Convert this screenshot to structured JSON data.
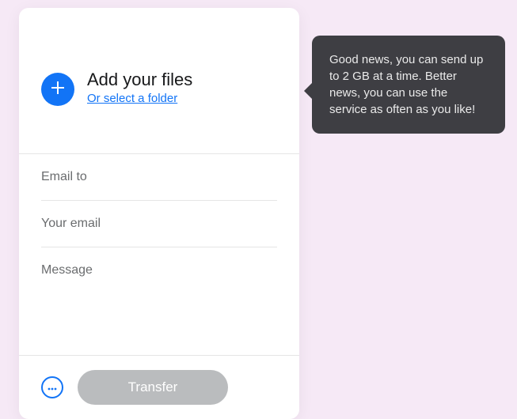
{
  "upload": {
    "heading": "Add your files",
    "folder_link": "Or select a folder"
  },
  "fields": {
    "email_to_placeholder": "Email to",
    "your_email_placeholder": "Your email",
    "message_placeholder": "Message"
  },
  "footer": {
    "transfer_label": "Transfer"
  },
  "tooltip": {
    "text": "Good news, you can send up to 2 GB at a time. Better news, you can use the service as often as you like!"
  },
  "colors": {
    "accent": "#1274f6",
    "disabled": "#babcbe",
    "tooltip_bg": "#3e3e43"
  }
}
